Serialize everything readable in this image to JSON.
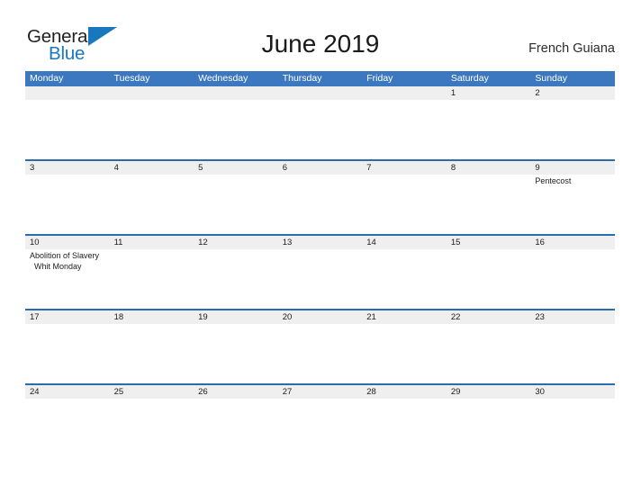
{
  "brand": {
    "name_part1": "General",
    "name_part2": "Blue",
    "flag_icon": "blue-triangle-flag-icon",
    "color_dark": "#231f20",
    "color_blue": "#1878be"
  },
  "header": {
    "title": "June 2019",
    "region": "French Guiana"
  },
  "theme": {
    "header_blue": "#3c78bf",
    "divider_blue": "#2b6cad",
    "date_strip_gray": "#efefef",
    "body_white": "#ffffff"
  },
  "calendar": {
    "weekday_headers": [
      "Monday",
      "Tuesday",
      "Wednesday",
      "Thursday",
      "Friday",
      "Saturday",
      "Sunday"
    ],
    "weeks": [
      {
        "days": [
          {
            "number": "",
            "events": []
          },
          {
            "number": "",
            "events": []
          },
          {
            "number": "",
            "events": []
          },
          {
            "number": "",
            "events": []
          },
          {
            "number": "",
            "events": []
          },
          {
            "number": "1",
            "events": []
          },
          {
            "number": "2",
            "events": []
          }
        ]
      },
      {
        "days": [
          {
            "number": "3",
            "events": []
          },
          {
            "number": "4",
            "events": []
          },
          {
            "number": "5",
            "events": []
          },
          {
            "number": "6",
            "events": []
          },
          {
            "number": "7",
            "events": []
          },
          {
            "number": "8",
            "events": []
          },
          {
            "number": "9",
            "events": [
              "Pentecost"
            ]
          }
        ]
      },
      {
        "days": [
          {
            "number": "10",
            "events": [
              "Abolition of Slavery",
              "Whit Monday"
            ]
          },
          {
            "number": "11",
            "events": []
          },
          {
            "number": "12",
            "events": []
          },
          {
            "number": "13",
            "events": []
          },
          {
            "number": "14",
            "events": []
          },
          {
            "number": "15",
            "events": []
          },
          {
            "number": "16",
            "events": []
          }
        ]
      },
      {
        "days": [
          {
            "number": "17",
            "events": []
          },
          {
            "number": "18",
            "events": []
          },
          {
            "number": "19",
            "events": []
          },
          {
            "number": "20",
            "events": []
          },
          {
            "number": "21",
            "events": []
          },
          {
            "number": "22",
            "events": []
          },
          {
            "number": "23",
            "events": []
          }
        ]
      },
      {
        "days": [
          {
            "number": "24",
            "events": []
          },
          {
            "number": "25",
            "events": []
          },
          {
            "number": "26",
            "events": []
          },
          {
            "number": "27",
            "events": []
          },
          {
            "number": "28",
            "events": []
          },
          {
            "number": "29",
            "events": []
          },
          {
            "number": "30",
            "events": []
          }
        ]
      }
    ]
  }
}
